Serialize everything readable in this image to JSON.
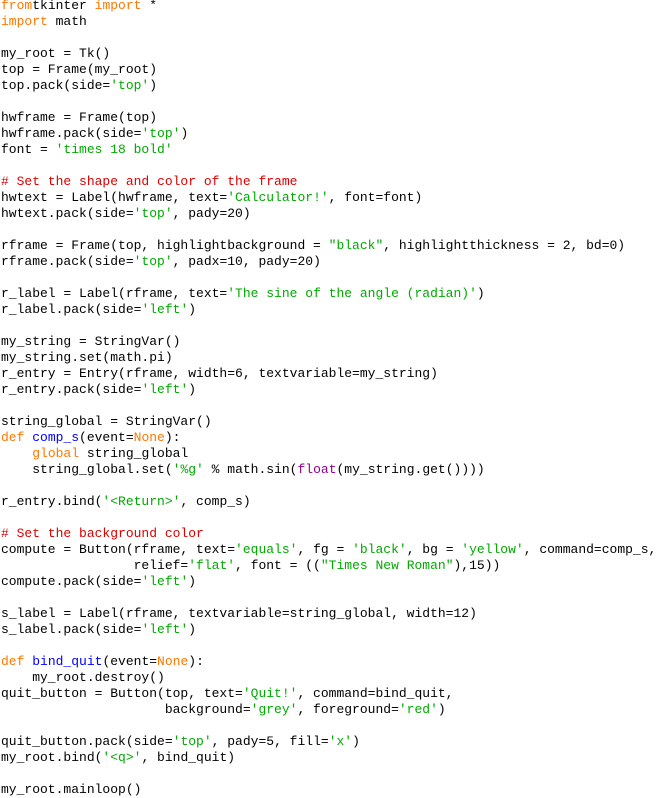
{
  "editor": {
    "language": "python",
    "colors": {
      "keyword": "#ff7700",
      "string": "#00aa00",
      "comment": "#dd0000",
      "function_name": "#0000ff",
      "builtin": "#900090",
      "text": "#000000",
      "background": "#ffffff"
    },
    "lines": [
      [
        [
          "kw",
          "from"
        ],
        [
          "",
          "tkinter "
        ],
        [
          "kw",
          "import"
        ],
        [
          "",
          " *"
        ]
      ],
      [
        [
          "kw",
          "import"
        ],
        [
          "",
          " math"
        ]
      ],
      [],
      [
        [
          "",
          "my_root = Tk()"
        ]
      ],
      [
        [
          "",
          "top = Frame(my_root)"
        ]
      ],
      [
        [
          "",
          "top.pack(side="
        ],
        [
          "str",
          "'top'"
        ],
        [
          "",
          ")"
        ]
      ],
      [],
      [
        [
          "",
          "hwframe = Frame(top)"
        ]
      ],
      [
        [
          "",
          "hwframe.pack(side="
        ],
        [
          "str",
          "'top'"
        ],
        [
          "",
          ")"
        ]
      ],
      [
        [
          "",
          "font = "
        ],
        [
          "str",
          "'times 18 bold'"
        ]
      ],
      [],
      [
        [
          "cmt",
          "# Set the shape and color of the frame"
        ]
      ],
      [
        [
          "",
          "hwtext = Label(hwframe, text="
        ],
        [
          "str",
          "'Calculator!'"
        ],
        [
          "",
          ", font=font)"
        ]
      ],
      [
        [
          "",
          "hwtext.pack(side="
        ],
        [
          "str",
          "'top'"
        ],
        [
          "",
          ", pady=20)"
        ]
      ],
      [],
      [
        [
          "",
          "rframe = Frame(top, highlightbackground = "
        ],
        [
          "str",
          "\"black\""
        ],
        [
          "",
          ", highlightthickness = 2, bd=0)"
        ]
      ],
      [
        [
          "",
          "rframe.pack(side="
        ],
        [
          "str",
          "'top'"
        ],
        [
          "",
          ", padx=10, pady=20)"
        ]
      ],
      [],
      [
        [
          "",
          "r_label = Label(rframe, text="
        ],
        [
          "str",
          "'The sine of the angle (radian)'"
        ],
        [
          "",
          ")"
        ]
      ],
      [
        [
          "",
          "r_label.pack(side="
        ],
        [
          "str",
          "'left'"
        ],
        [
          "",
          ")"
        ]
      ],
      [],
      [
        [
          "",
          "my_string = StringVar()"
        ]
      ],
      [
        [
          "",
          "my_string.set(math.pi)"
        ]
      ],
      [
        [
          "",
          "r_entry = Entry(rframe, width=6, textvariable=my_string)"
        ]
      ],
      [
        [
          "",
          "r_entry.pack(side="
        ],
        [
          "str",
          "'left'"
        ],
        [
          "",
          ")"
        ]
      ],
      [],
      [
        [
          "",
          "string_global = StringVar()"
        ]
      ],
      [
        [
          "kw",
          "def"
        ],
        [
          "",
          " "
        ],
        [
          "fn",
          "comp_s"
        ],
        [
          "",
          "(event="
        ],
        [
          "kw",
          "None"
        ],
        [
          "",
          "):"
        ]
      ],
      [
        [
          "",
          "    "
        ],
        [
          "kw",
          "global"
        ],
        [
          "",
          " string_global"
        ]
      ],
      [
        [
          "",
          "    string_global.set("
        ],
        [
          "str",
          "'%g'"
        ],
        [
          "",
          " % math.sin("
        ],
        [
          "bi",
          "float"
        ],
        [
          "",
          "(my_string.get())))"
        ]
      ],
      [],
      [
        [
          "",
          "r_entry.bind("
        ],
        [
          "str",
          "'<Return>'"
        ],
        [
          "",
          ", comp_s)"
        ]
      ],
      [],
      [
        [
          "cmt",
          "# Set the background color"
        ]
      ],
      [
        [
          "",
          "compute = Button(rframe, text="
        ],
        [
          "str",
          "'equals'"
        ],
        [
          "",
          ", fg = "
        ],
        [
          "str",
          "'black'"
        ],
        [
          "",
          ", bg = "
        ],
        [
          "str",
          "'yellow'"
        ],
        [
          "",
          ", command=comp_s,"
        ]
      ],
      [
        [
          "",
          "                 relief="
        ],
        [
          "str",
          "'flat'"
        ],
        [
          "",
          ", font = (("
        ],
        [
          "str",
          "\"Times New Roman\""
        ],
        [
          "",
          "),15))"
        ]
      ],
      [
        [
          "",
          "compute.pack(side="
        ],
        [
          "str",
          "'left'"
        ],
        [
          "",
          ")"
        ]
      ],
      [],
      [
        [
          "",
          "s_label = Label(rframe, textvariable=string_global, width=12)"
        ]
      ],
      [
        [
          "",
          "s_label.pack(side="
        ],
        [
          "str",
          "'left'"
        ],
        [
          "",
          ")"
        ]
      ],
      [],
      [
        [
          "kw",
          "def"
        ],
        [
          "",
          " "
        ],
        [
          "fn",
          "bind_quit"
        ],
        [
          "",
          "(event="
        ],
        [
          "kw",
          "None"
        ],
        [
          "",
          "):"
        ]
      ],
      [
        [
          "",
          "    my_root.destroy()"
        ]
      ],
      [
        [
          "",
          "quit_button = Button(top, text="
        ],
        [
          "str",
          "'Quit!'"
        ],
        [
          "",
          ", command=bind_quit,"
        ]
      ],
      [
        [
          "",
          "                     background="
        ],
        [
          "str",
          "'grey'"
        ],
        [
          "",
          ", foreground="
        ],
        [
          "str",
          "'red'"
        ],
        [
          "",
          ")"
        ]
      ],
      [],
      [
        [
          "",
          "quit_button.pack(side="
        ],
        [
          "str",
          "'top'"
        ],
        [
          "",
          ", pady=5, fill="
        ],
        [
          "str",
          "'x'"
        ],
        [
          "",
          ")"
        ]
      ],
      [
        [
          "",
          "my_root.bind("
        ],
        [
          "str",
          "'<q>'"
        ],
        [
          "",
          ", bind_quit)"
        ]
      ],
      [],
      [
        [
          "",
          "my_root.mainloop()"
        ]
      ]
    ]
  }
}
